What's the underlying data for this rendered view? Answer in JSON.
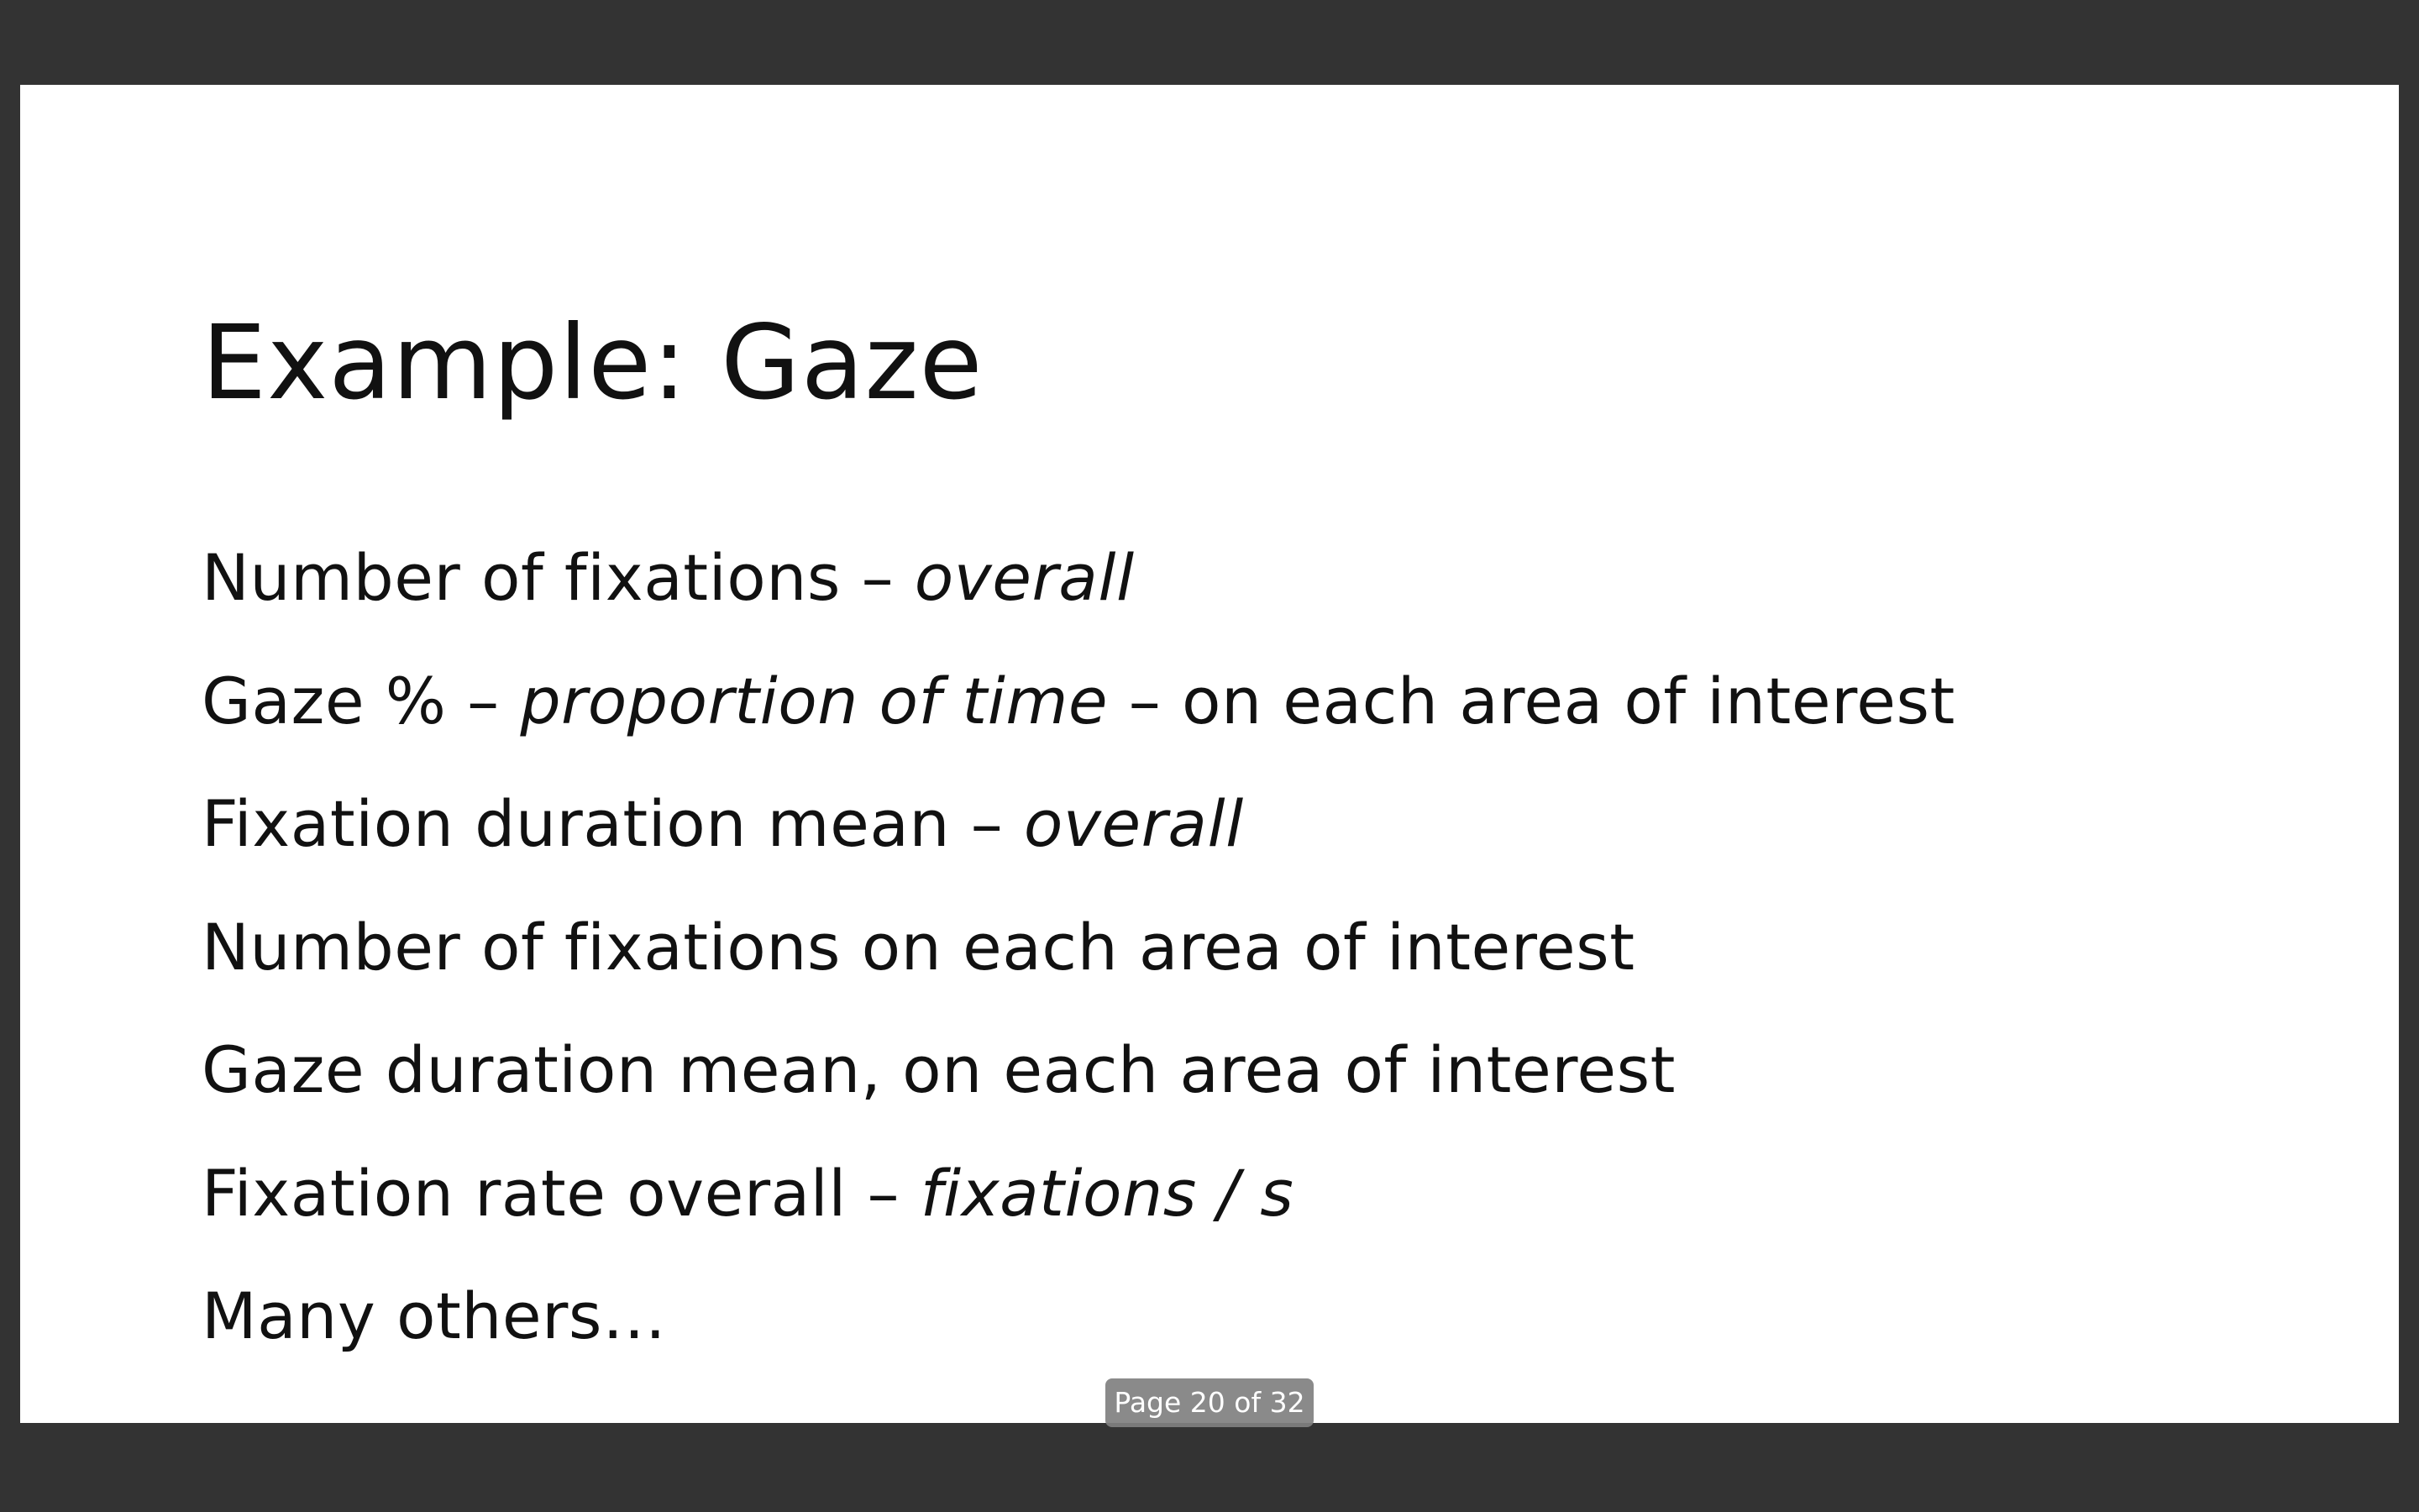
{
  "slide": {
    "title": "Example: Gaze",
    "bullets": [
      [
        {
          "text": "Number of fixations – ",
          "italic": false
        },
        {
          "text": "overall",
          "italic": true
        }
      ],
      [
        {
          "text": "Gaze % – ",
          "italic": false
        },
        {
          "text": "proportion of time",
          "italic": true
        },
        {
          "text": " – on each area of interest",
          "italic": false
        }
      ],
      [
        {
          "text": "Fixation duration mean – ",
          "italic": false
        },
        {
          "text": "overall",
          "italic": true
        }
      ],
      [
        {
          "text": "Number of fixations on each area of interest",
          "italic": false
        }
      ],
      [
        {
          "text": "Gaze duration mean, on each area of interest",
          "italic": false
        }
      ],
      [
        {
          "text": "Fixation rate overall – ",
          "italic": false
        },
        {
          "text": "fixations / s",
          "italic": true
        }
      ],
      [
        {
          "text": "Many others…",
          "italic": false
        }
      ]
    ]
  },
  "page_indicator": {
    "label": "Page 20 of 32",
    "current_page": 20,
    "total_pages": 32
  },
  "colors": {
    "viewer_background": "#333333",
    "slide_background": "#ffffff",
    "text": "#111111",
    "indicator_background": "#808080",
    "indicator_text": "#ffffff"
  }
}
